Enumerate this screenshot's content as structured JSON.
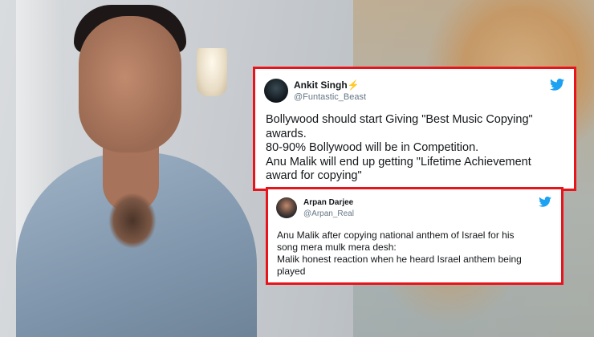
{
  "tweets": [
    {
      "name": "Ankit Singh",
      "badge": "⚡",
      "handle": "@Funtastic_Beast",
      "lines": [
        "Bollywood should start Giving \"Best Music Copying\"",
        "awards.",
        "80-90% Bollywood will be in Competition.",
        "Anu Malik will end up getting \"Lifetime Achievement",
        "award for copying\""
      ]
    },
    {
      "name": "Arpan Darjee",
      "handle": "@Arpan_Real",
      "lines": [
        "Anu Malik after copying national anthem of Israel for his",
        "song mera mulk mera desh:",
        "Malik honest reaction when he heard Israel anthem being",
        "played"
      ]
    }
  ],
  "colors": {
    "highlight_border": "#e8141b",
    "twitter_blue": "#1da1f2"
  },
  "icons": [
    "twitter-bird-icon",
    "lightning-bolt-icon"
  ]
}
